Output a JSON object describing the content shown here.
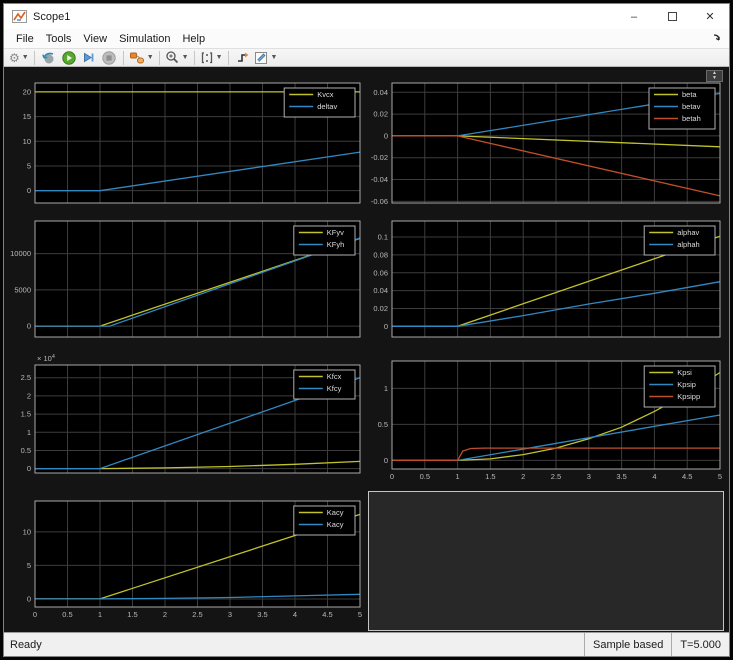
{
  "window": {
    "title": "Scope1",
    "minimize_glyph": "–",
    "close_glyph": "✕"
  },
  "menu": {
    "items": [
      {
        "label": "File"
      },
      {
        "label": "Tools"
      },
      {
        "label": "View"
      },
      {
        "label": "Simulation"
      },
      {
        "label": "Help"
      }
    ]
  },
  "toolbar": {
    "buttons": [
      "configuration-properties",
      "goto-model",
      "run",
      "step-forward",
      "stop",
      "highlight-simulink-block",
      "zoom",
      "axes-scaling",
      "trigger",
      "measurements"
    ]
  },
  "status": {
    "left": "Ready",
    "mode": "Sample based",
    "time": "T=5.000"
  },
  "palette": {
    "yellow": "#c2c22b",
    "blue": "#3288c2",
    "orange": "#c14f2b"
  },
  "colors": {
    "figure_bg": "#141414",
    "axes_bg": "#000000",
    "grid": "#3c3c3c",
    "axes_border": "#a9a9a9",
    "tick_text": "#b9b9b9",
    "legend_bg": "#000000",
    "legend_border": "#b0b0b0",
    "legend_text": "#dcdcdc"
  },
  "axes": {
    "xticks": [
      0,
      0.5,
      1,
      1.5,
      2,
      2.5,
      3,
      3.5,
      4,
      4.5,
      5
    ]
  },
  "chart_data": [
    {
      "type": "line",
      "name": "kvcx-deltav",
      "xlim": [
        0,
        5
      ],
      "ylim": [
        -2.5,
        21.8
      ],
      "yticks": [
        0,
        5,
        10,
        15,
        20
      ],
      "show_x_labels": false,
      "exponent": null,
      "legend": [
        "Kvcx",
        "deltav"
      ],
      "series": [
        {
          "name": "Kvcx",
          "color": "yellow",
          "points": [
            [
              0,
              20
            ],
            [
              5,
              20
            ]
          ]
        },
        {
          "name": "deltav",
          "color": "blue",
          "points": [
            [
              0,
              0
            ],
            [
              1,
              0
            ],
            [
              5,
              7.8
            ]
          ]
        }
      ]
    },
    {
      "type": "line",
      "name": "beta-betav-betah",
      "xlim": [
        0,
        5
      ],
      "ylim": [
        -0.0615,
        0.0485
      ],
      "yticks": [
        0.04,
        0.02,
        0,
        -0.02,
        -0.04,
        -0.06
      ],
      "show_x_labels": false,
      "exponent": null,
      "legend": [
        "beta",
        "betav",
        "betah"
      ],
      "series": [
        {
          "name": "beta",
          "color": "yellow",
          "points": [
            [
              0,
              0
            ],
            [
              1,
              0
            ],
            [
              5,
              -0.01
            ]
          ]
        },
        {
          "name": "betav",
          "color": "blue",
          "points": [
            [
              0,
              0
            ],
            [
              1,
              0
            ],
            [
              5,
              0.039
            ]
          ]
        },
        {
          "name": "betah",
          "color": "orange",
          "points": [
            [
              0,
              0
            ],
            [
              1,
              0
            ],
            [
              5,
              -0.055
            ]
          ]
        }
      ]
    },
    {
      "type": "line",
      "name": "kfyv-kfyh",
      "xlim": [
        0,
        5
      ],
      "ylim": [
        -1500,
        14500
      ],
      "yticks": [
        0,
        5000,
        10000
      ],
      "show_x_labels": false,
      "exponent": null,
      "legend": [
        "KFyv",
        "KFyh"
      ],
      "series": [
        {
          "name": "KFyv",
          "color": "yellow",
          "points": [
            [
              0,
              0
            ],
            [
              1,
              0
            ],
            [
              5,
              12100
            ]
          ]
        },
        {
          "name": "KFyh",
          "color": "blue",
          "points": [
            [
              0,
              0
            ],
            [
              1.15,
              0
            ],
            [
              5,
              12150
            ]
          ]
        }
      ]
    },
    {
      "type": "line",
      "name": "alphav-alphah",
      "xlim": [
        0,
        5
      ],
      "ylim": [
        -0.012,
        0.118
      ],
      "yticks": [
        0,
        0.02,
        0.04,
        0.06,
        0.08,
        0.1
      ],
      "show_x_labels": false,
      "exponent": null,
      "legend": [
        "alphav",
        "alphah"
      ],
      "series": [
        {
          "name": "alphav",
          "color": "yellow",
          "points": [
            [
              0,
              0
            ],
            [
              1,
              0
            ],
            [
              5,
              0.101
            ]
          ]
        },
        {
          "name": "alphah",
          "color": "blue",
          "points": [
            [
              0,
              0
            ],
            [
              1,
              0
            ],
            [
              2,
              0.012
            ],
            [
              3,
              0.025
            ],
            [
              4,
              0.037
            ],
            [
              5,
              0.05
            ]
          ]
        }
      ]
    },
    {
      "type": "line",
      "name": "kfcx-kfcy",
      "xlim": [
        0,
        5
      ],
      "ylim": [
        -0.12,
        2.85
      ],
      "yticks": [
        0,
        0.5,
        1,
        1.5,
        2,
        2.5
      ],
      "show_x_labels": false,
      "exponent": {
        "text": "× 10",
        "sup": "4"
      },
      "legend": [
        "Kfcx",
        "Kfcy"
      ],
      "series": [
        {
          "name": "Kfcx",
          "color": "yellow",
          "points": [
            [
              0,
              0
            ],
            [
              1,
              0
            ],
            [
              2,
              0.02
            ],
            [
              3,
              0.06
            ],
            [
              4,
              0.12
            ],
            [
              5,
              0.2
            ]
          ]
        },
        {
          "name": "Kfcy",
          "color": "blue",
          "points": [
            [
              0,
              0
            ],
            [
              1,
              0
            ],
            [
              5,
              2.5
            ]
          ]
        }
      ]
    },
    {
      "type": "line",
      "name": "kpsi-kpsip-kpsipp",
      "xlim": [
        0,
        5
      ],
      "ylim": [
        -0.12,
        1.38
      ],
      "yticks": [
        0,
        0.5,
        1
      ],
      "show_x_labels": true,
      "exponent": null,
      "legend": [
        "Kpsi",
        "Kpsip",
        "Kpsipp"
      ],
      "series": [
        {
          "name": "Kpsi",
          "color": "yellow",
          "points": [
            [
              0,
              0
            ],
            [
              1,
              0
            ],
            [
              1.5,
              0.02
            ],
            [
              2,
              0.08
            ],
            [
              2.5,
              0.17
            ],
            [
              3,
              0.3
            ],
            [
              3.5,
              0.46
            ],
            [
              4,
              0.68
            ],
            [
              4.5,
              0.93
            ],
            [
              5,
              1.22
            ]
          ]
        },
        {
          "name": "Kpsip",
          "color": "blue",
          "points": [
            [
              0,
              0
            ],
            [
              1,
              0
            ],
            [
              5,
              0.63
            ]
          ]
        },
        {
          "name": "Kpsipp",
          "color": "orange",
          "points": [
            [
              0,
              0
            ],
            [
              1,
              0
            ],
            [
              1.08,
              0.13
            ],
            [
              1.2,
              0.165
            ],
            [
              1.4,
              0.17
            ],
            [
              5,
              0.17
            ]
          ]
        }
      ]
    },
    {
      "type": "line",
      "name": "kacy-kacy",
      "xlim": [
        0,
        5
      ],
      "ylim": [
        -1.2,
        14.6
      ],
      "yticks": [
        0,
        5,
        10
      ],
      "show_x_labels": true,
      "exponent": null,
      "legend": [
        "Kacy",
        "Kacy"
      ],
      "series": [
        {
          "name": "Kacy",
          "color": "yellow",
          "points": [
            [
              0,
              0
            ],
            [
              1,
              0
            ],
            [
              5,
              12.6
            ]
          ]
        },
        {
          "name": "Kacy",
          "color": "blue",
          "points": [
            [
              0,
              0
            ],
            [
              1,
              0
            ],
            [
              2,
              0.08
            ],
            [
              3,
              0.22
            ],
            [
              4,
              0.45
            ],
            [
              5,
              0.7
            ]
          ]
        }
      ]
    }
  ]
}
